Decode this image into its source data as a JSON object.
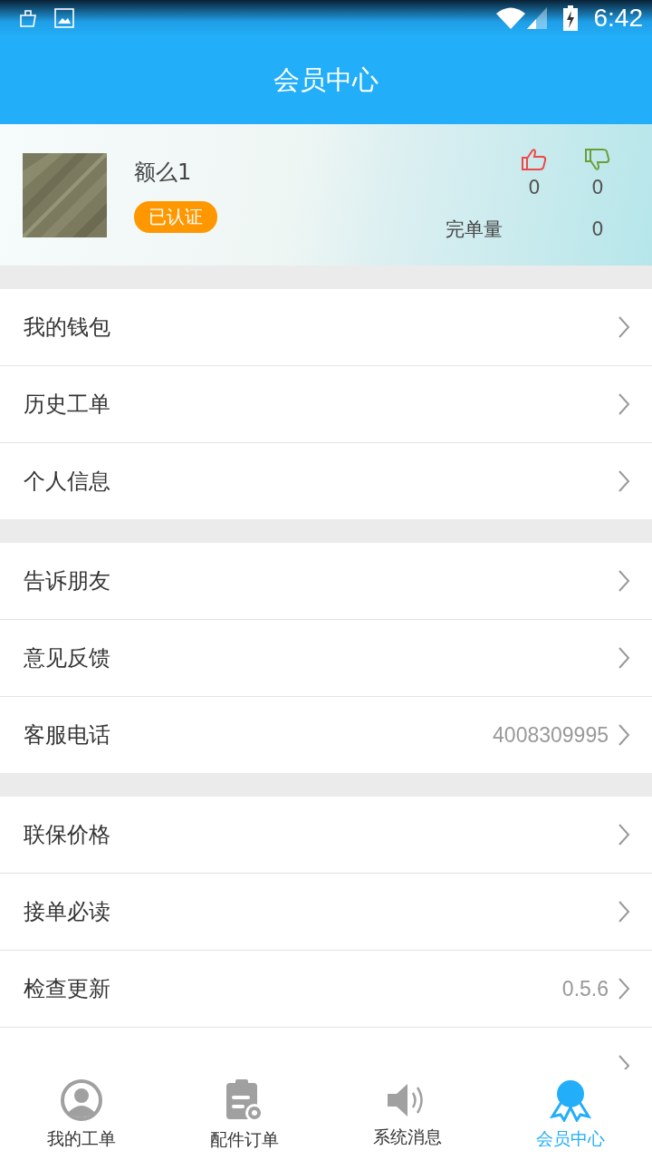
{
  "status_bar": {
    "time": "6:42"
  },
  "header": {
    "title": "会员中心"
  },
  "profile": {
    "name": "额么1",
    "badge": "已认证",
    "likes": "0",
    "dislikes": "0",
    "orders_label": "完单量",
    "orders": "0"
  },
  "menu_groups": [
    {
      "items": [
        {
          "label": "我的钱包"
        },
        {
          "label": "历史工单"
        },
        {
          "label": "个人信息"
        }
      ]
    },
    {
      "items": [
        {
          "label": "告诉朋友"
        },
        {
          "label": "意见反馈"
        },
        {
          "label": "客服电话",
          "value": "4008309995"
        }
      ]
    },
    {
      "items": [
        {
          "label": "联保价格"
        },
        {
          "label": "接单必读"
        },
        {
          "label": "检查更新",
          "value": "0.5.6"
        }
      ]
    }
  ],
  "bottom_nav": [
    {
      "kind": "person",
      "label": "我的工单",
      "selected": false
    },
    {
      "kind": "clipboard",
      "label": "配件订单",
      "selected": false
    },
    {
      "kind": "speaker",
      "label": "系统消息",
      "selected": false
    },
    {
      "kind": "medal",
      "label": "会员中心",
      "selected": true
    }
  ]
}
